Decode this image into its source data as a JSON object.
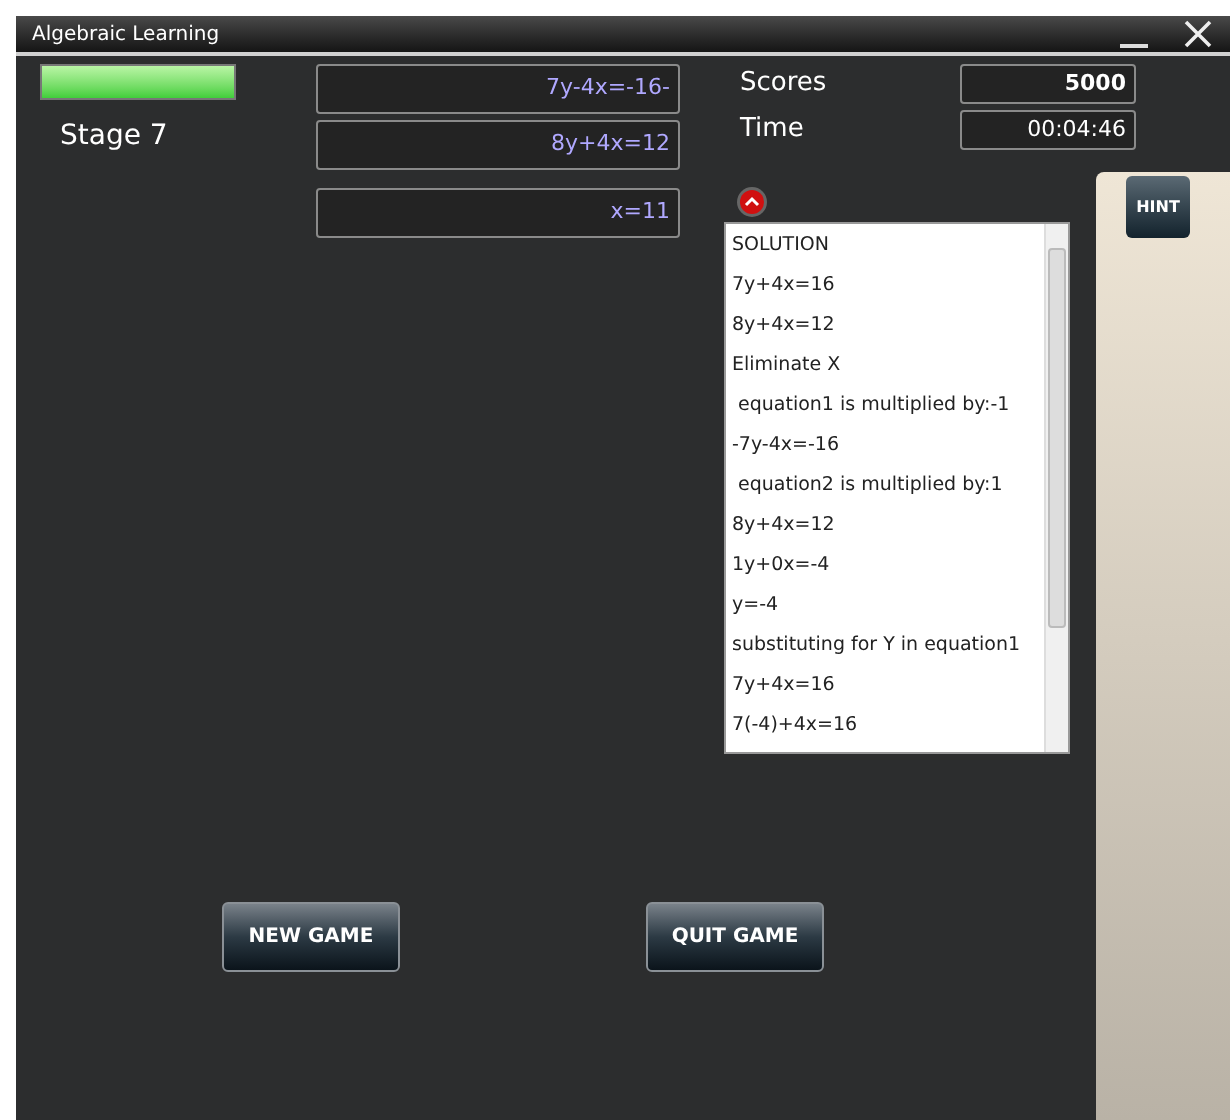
{
  "window": {
    "title": "Algebraic Learning"
  },
  "progress": {
    "level": 1.0
  },
  "stage": "Stage 7",
  "equations": [
    "7y-4x=-16-",
    "8y+4x=12"
  ],
  "answer": "x=11",
  "scores": {
    "label": "Scores",
    "value": "5000"
  },
  "time": {
    "label": "Time",
    "value": "00:04:46"
  },
  "solution": [
    "SOLUTION",
    "7y+4x=16",
    "8y+4x=12",
    "Eliminate X",
    " equation1 is multiplied by:-1",
    "-7y-4x=-16",
    " equation2 is multiplied by:1",
    "8y+4x=12",
    "1y+0x=-4",
    "y=-4",
    "substituting for Y in equation1",
    "7y+4x=16",
    "7(-4)+4x=16"
  ],
  "hint_button": "HINT",
  "buttons": [
    "NEW GAME",
    "QUIT GAME"
  ]
}
